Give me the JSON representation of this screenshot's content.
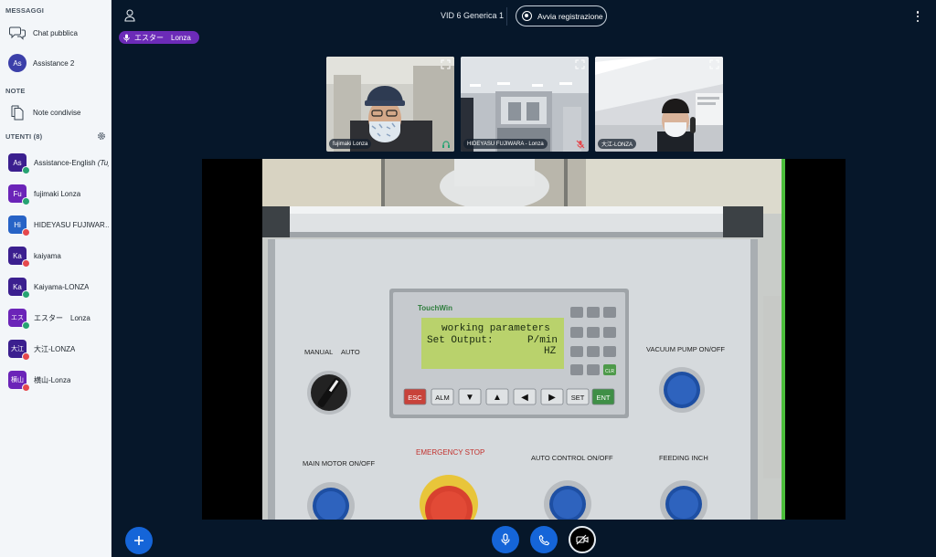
{
  "sidebar": {
    "messages_title": "MESSAGGI",
    "public_chat": "Chat pubblica",
    "assistance": {
      "initials": "As",
      "label": "Assistance 2",
      "color": "#3b3fa9"
    },
    "notes_title": "NOTE",
    "shared_notes": "Note condivise",
    "users_title": "UTENTI (8)",
    "users": [
      {
        "initials": "As",
        "name": "Assistance-English",
        "suffix": "(Tu)",
        "color": "#3b1f8f",
        "status": "listen"
      },
      {
        "initials": "Fu",
        "name": "fujimaki Lonza",
        "suffix": "",
        "color": "#6b24b8",
        "status": "listen"
      },
      {
        "initials": "Hi",
        "name": "HIDEYASU FUJIWAR…",
        "suffix": "",
        "color": "#2763c6",
        "status": "muted"
      },
      {
        "initials": "Ka",
        "name": "kaiyama",
        "suffix": "",
        "color": "#3b1f8f",
        "status": "muted"
      },
      {
        "initials": "Ka",
        "name": "Kaiyama-LONZA",
        "suffix": "",
        "color": "#3b1f8f",
        "status": "listen"
      },
      {
        "initials": "エス",
        "name": "エスター　Lonza",
        "suffix": "",
        "color": "#6b24b8",
        "status": "listen"
      },
      {
        "initials": "大江",
        "name": "大江-LONZA",
        "suffix": "",
        "color": "#3b1f8f",
        "status": "muted"
      },
      {
        "initials": "横山",
        "name": "横山-Lonza",
        "suffix": "",
        "color": "#6b24b8",
        "status": "muted"
      }
    ]
  },
  "header": {
    "room_name": "VID 6 Generica 1",
    "record_label": "Avvia registrazione"
  },
  "talking": {
    "label": "エスター　Lonza"
  },
  "thumbnails": [
    {
      "name": "fujimaki Lonza",
      "status": "listen"
    },
    {
      "name": "HIDEYASU FUJIWARA - Lonza",
      "status": "muted"
    },
    {
      "name": "大江-LONZA",
      "status": "none"
    }
  ],
  "machine_panel": {
    "brand": "TouchWin",
    "lcd_line1": "working parameters",
    "lcd_line2_left": "Set Output:",
    "lcd_line2_right": "P/min",
    "lcd_line3": "HZ",
    "keys": [
      "ESC",
      "ALM",
      "▼",
      "▲",
      "◀",
      "▶",
      "SET",
      "ENT"
    ],
    "keypad_clr": "CLR",
    "manual_label": "MANUAL",
    "auto_label": "AUTO",
    "vacuum_label": "VACUUM PUMP ON/OFF",
    "main_motor_label": "MAIN MOTOR ON/OFF",
    "emergency_label": "EMERGENCY STOP",
    "auto_control_label": "AUTO CONTROL ON/OFF",
    "feeding_label": "FEEDING INCH"
  },
  "colors": {
    "accent": "#1565d8",
    "talker": "#6c2bb8",
    "muted": "#e5484d",
    "listen": "#27a372"
  }
}
